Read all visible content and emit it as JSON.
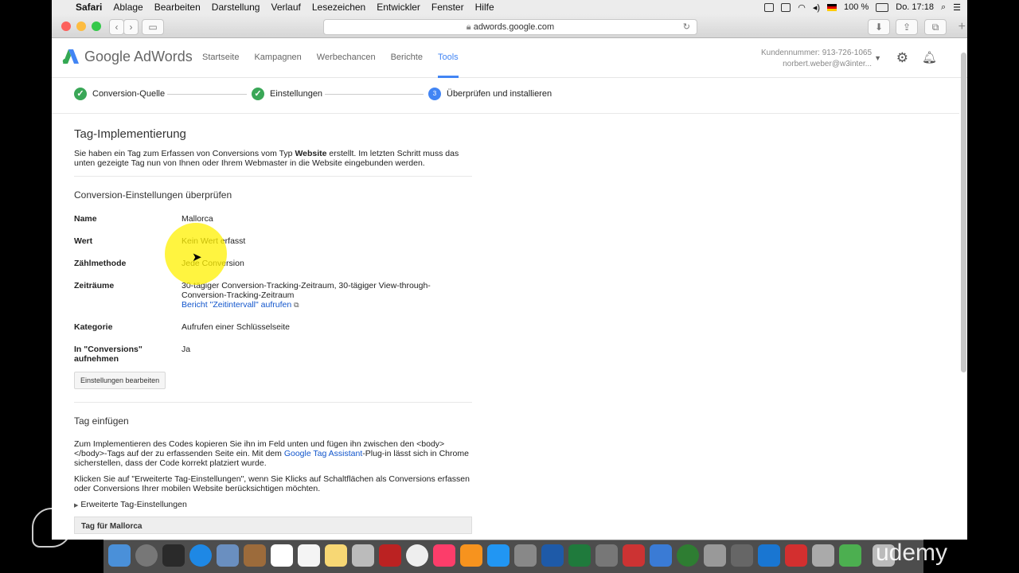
{
  "menubar": {
    "app": "Safari",
    "items": [
      "Ablage",
      "Bearbeiten",
      "Darstellung",
      "Verlauf",
      "Lesezeichen",
      "Entwickler",
      "Fenster",
      "Hilfe"
    ],
    "battery": "100 %",
    "time": "Do. 17:18"
  },
  "browser": {
    "url": "adwords.google.com"
  },
  "header": {
    "logo": "Google AdWords",
    "nav": [
      "Startseite",
      "Kampagnen",
      "Werbechancen",
      "Berichte",
      "Tools"
    ],
    "active_nav": "Tools",
    "customer_number": "Kundennummer: 913-726-1065",
    "email": "norbert.weber@w3inter..."
  },
  "steps": [
    {
      "label": "Conversion-Quelle",
      "state": "done"
    },
    {
      "label": "Einstellungen",
      "state": "done"
    },
    {
      "label": "Überprüfen und installieren",
      "state": "current",
      "number": "3"
    }
  ],
  "tag_impl": {
    "title": "Tag-Implementierung",
    "desc_1": "Sie haben ein Tag zum Erfassen von Conversions vom Typ ",
    "desc_bold": "Website",
    "desc_2": " erstellt. Im letzten Schritt muss das",
    "desc_line2": "unten gezeigte Tag nun von Ihnen oder Ihrem Webmaster in die Website eingebunden werden."
  },
  "review": {
    "title": "Conversion-Einstellungen überprüfen",
    "rows": [
      {
        "label": "Name",
        "value": "Mallorca"
      },
      {
        "label": "Wert",
        "value": "Kein Wert erfasst"
      },
      {
        "label": "Zählmethode",
        "value": "Jede Conversion"
      },
      {
        "label": "Zeiträume",
        "value": "30-tägiger Conversion-Tracking-Zeitraum, 30-tägiger View-through-",
        "value2": "Conversion-Tracking-Zeitraum",
        "link": "Bericht \"Zeitintervall\" aufrufen"
      },
      {
        "label": "Kategorie",
        "value": "Aufrufen einer Schlüsselseite"
      },
      {
        "label": "In \"Conversions\"",
        "label2": "aufnehmen",
        "value": "Ja"
      }
    ],
    "edit_button": "Einstellungen bearbeiten"
  },
  "insert": {
    "title": "Tag einfügen",
    "p1_line1": "Zum Implementieren des Codes kopieren Sie ihn im Feld unten und fügen ihn zwischen den <body>",
    "p1_line2a": "</body>-Tags auf der zu erfassenden Seite ein. Mit dem ",
    "p1_link": "Google Tag Assistant",
    "p1_line2b": "-Plug-in lässt sich in Chrome",
    "p1_line3": "sicherstellen, dass der Code korrekt platziert wurde.",
    "p2_line1": "Klicken Sie auf \"Erweiterte Tag-Einstellungen\", wenn Sie Klicks auf Schaltflächen als Conversions erfassen",
    "p2_line2": "oder Conversions Ihrer mobilen Website berücksichtigen möchten.",
    "advanced": "Erweiterte Tag-Einstellungen",
    "tag_for": "Tag für Mallorca"
  },
  "watermark": "udemy"
}
